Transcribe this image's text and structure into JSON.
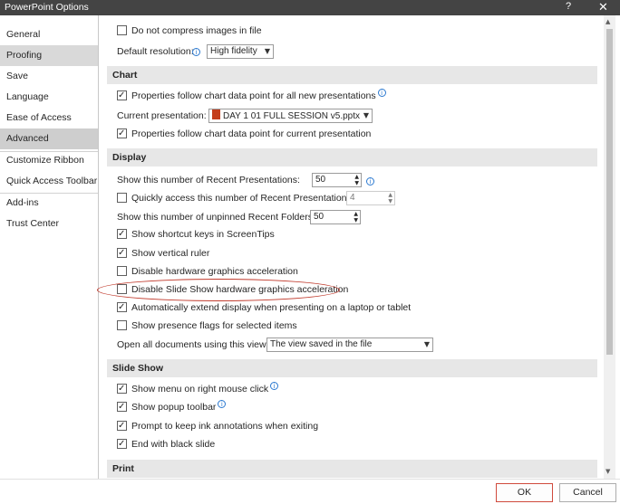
{
  "window": {
    "title": "PowerPoint Options",
    "help_glyph": "?",
    "close_glyph": "✕"
  },
  "nav": [
    {
      "label": "General"
    },
    {
      "label": "Proofing"
    },
    {
      "label": "Save"
    },
    {
      "label": "Language"
    },
    {
      "label": "Ease of Access"
    },
    {
      "label": "Advanced"
    },
    {
      "label": "Customize Ribbon"
    },
    {
      "label": "Quick Access Toolbar"
    },
    {
      "label": "Add-ins"
    },
    {
      "label": "Trust Center"
    }
  ],
  "image_size": {
    "do_not_compress": "Do not compress images in file",
    "default_resolution_label": "Default resolution:",
    "default_resolution_value": "High fidelity"
  },
  "chart": {
    "header": "Chart",
    "follow_all_new": "Properties follow chart data point for all new presentations",
    "current_presentation_label": "Current presentation:",
    "current_presentation_value": "DAY 1 01 FULL SESSION v5.pptx",
    "follow_current": "Properties follow chart data point for current presentation"
  },
  "display": {
    "header": "Display",
    "recent_presentations_label": "Show this number of Recent Presentations:",
    "recent_presentations_value": "50",
    "quick_access_label": "Quickly access this number of Recent Presentations:",
    "quick_access_value": "4",
    "unpinned_folders_label": "Show this number of unpinned Recent Folders:",
    "unpinned_folders_value": "50",
    "shortcut_keys": "Show shortcut keys in ScreenTips",
    "vertical_ruler": "Show vertical ruler",
    "disable_hw_accel": "Disable hardware graphics acceleration",
    "disable_slideshow_hw_accel": "Disable Slide Show hardware graphics acceleration",
    "auto_extend": "Automatically extend display when presenting on a laptop or tablet",
    "presence_flags": "Show presence flags for selected items",
    "open_all_label": "Open all documents using this view",
    "open_all_value": "The view saved in the file"
  },
  "slideshow": {
    "header": "Slide Show",
    "menu_right_click": "Show menu on right mouse click",
    "popup_toolbar": "Show popup toolbar",
    "keep_ink": "Prompt to keep ink annotations when exiting",
    "end_black": "End with black slide"
  },
  "print": {
    "header": "Print"
  },
  "buttons": {
    "ok": "OK",
    "cancel": "Cancel"
  },
  "icons": {
    "info": "i",
    "dropdown": "▼",
    "spin_up": "▲",
    "spin_down": "▼",
    "checkmark": "✓"
  },
  "colors": {
    "titlebar": "#444444",
    "section_bg": "#e7e7e7",
    "selected_nav": "#cecece",
    "info_blue": "#2b79d0",
    "annotation_red": "#c0392b",
    "pptx_icon": "#c43e1c"
  }
}
